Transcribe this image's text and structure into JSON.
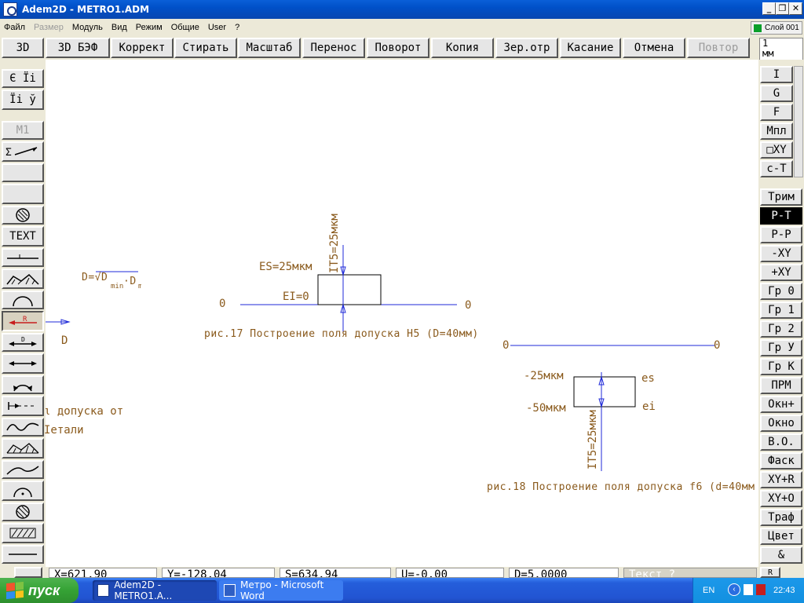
{
  "window": {
    "title": "Adem2D - METRO1.ADM"
  },
  "menu": [
    "Файл",
    "Размер",
    "Модуль",
    "Вид",
    "Режим",
    "Общие",
    "User",
    "?"
  ],
  "menu_disabled": [
    "Размер"
  ],
  "layer": "Слой 001",
  "toolbar": [
    "3D",
    "3D БЭФ",
    "Коррект",
    "Стирать",
    "Масштаб",
    "Перенос",
    "Поворот",
    "Копия",
    "Зер.отр",
    "Касание",
    "Отмена",
    "Повтор"
  ],
  "toolbar_disabled": [
    "Повтор"
  ],
  "scale": {
    "value": "1",
    "unit": "мм"
  },
  "right_tools_top": [
    "I",
    "G",
    "F",
    "Мпл",
    "□XY",
    "c-T"
  ],
  "right_tools": [
    "Трим",
    "P-T",
    "P-P",
    "-XY",
    "+XY",
    "Гр 0",
    "Гр 1",
    "Гр 2",
    "Гр У",
    "Гр К",
    "ПРМ",
    "Окн+",
    "Окно",
    "В.О.",
    "Фаск",
    "XY+R",
    "XY+O",
    "Траф",
    "Цвет",
    "&"
  ],
  "right_active": "P-T",
  "left_tools": {
    "top": [
      "Є Їі",
      "Їі ў"
    ],
    "m1": "M1",
    "text": "TEXT"
  },
  "drawing": {
    "label_it5": "IT5=25мкм",
    "label_es": "ES=25мкм",
    "label_ei": "EI=0",
    "zero": "0",
    "caption17": "рис.17 Построение поля допуска H5 (D=40мм)",
    "label_minus25": "-25мкм",
    "label_minus50": "-50мкм",
    "label_es_small": "es",
    "label_ei_small": "ei",
    "label_it5_b": "IT5=25мкм",
    "caption18": "рис.18 Построение поля допуска f6 (d=40мм",
    "formula_d": "D=√D",
    "formula_min": "min",
    "formula_max": "·D",
    "formula_max2": "max",
    "left_D": "D",
    "left_text1": "ι допуска от",
    "left_text2": "Іетали"
  },
  "status": {
    "x": "X=621.90",
    "y": "Y=-128.04",
    "s": "S=634.94",
    "u": "U=-0.00",
    "d": "D=5.0000",
    "hint": "Текст ?"
  },
  "taskbar": {
    "start": "пуск",
    "tasks": [
      "Adem2D - METRO1.A...",
      "Метро - Microsoft Word"
    ],
    "lang": "EN",
    "time": "22:43"
  },
  "colors": {
    "drawing_line": "#1f2ad8",
    "drawing_text": "#8a5a1c",
    "title_bar": "#0050c8"
  }
}
